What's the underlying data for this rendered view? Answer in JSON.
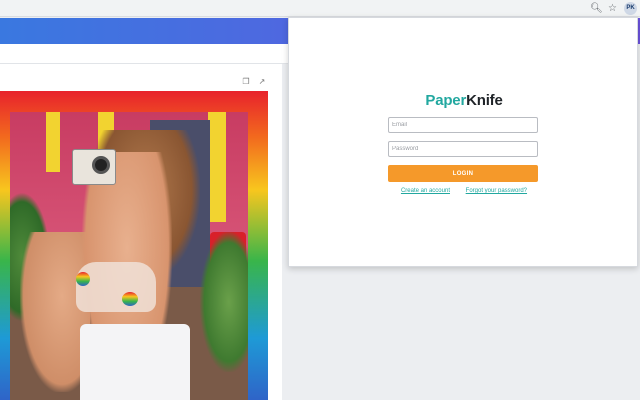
{
  "browser": {
    "icons": {
      "zoom": "zoom-icon",
      "bookmark": "star-icon"
    },
    "avatar_initials": "PK"
  },
  "image_panel": {
    "icons": {
      "copy": "copy-icon",
      "share": "share-icon"
    }
  },
  "login": {
    "logo_part1": "Paper",
    "logo_part2": "Knife",
    "email_placeholder": "Email",
    "password_placeholder": "Password",
    "login_label": "LOGIN",
    "create_account": "Create an account",
    "forgot_password": "Forgot your password?"
  },
  "colors": {
    "accent_teal": "#22a8a0",
    "login_orange": "#f5992a",
    "header_blue": "#3a78e0",
    "header_purple": "#6a52dc"
  }
}
